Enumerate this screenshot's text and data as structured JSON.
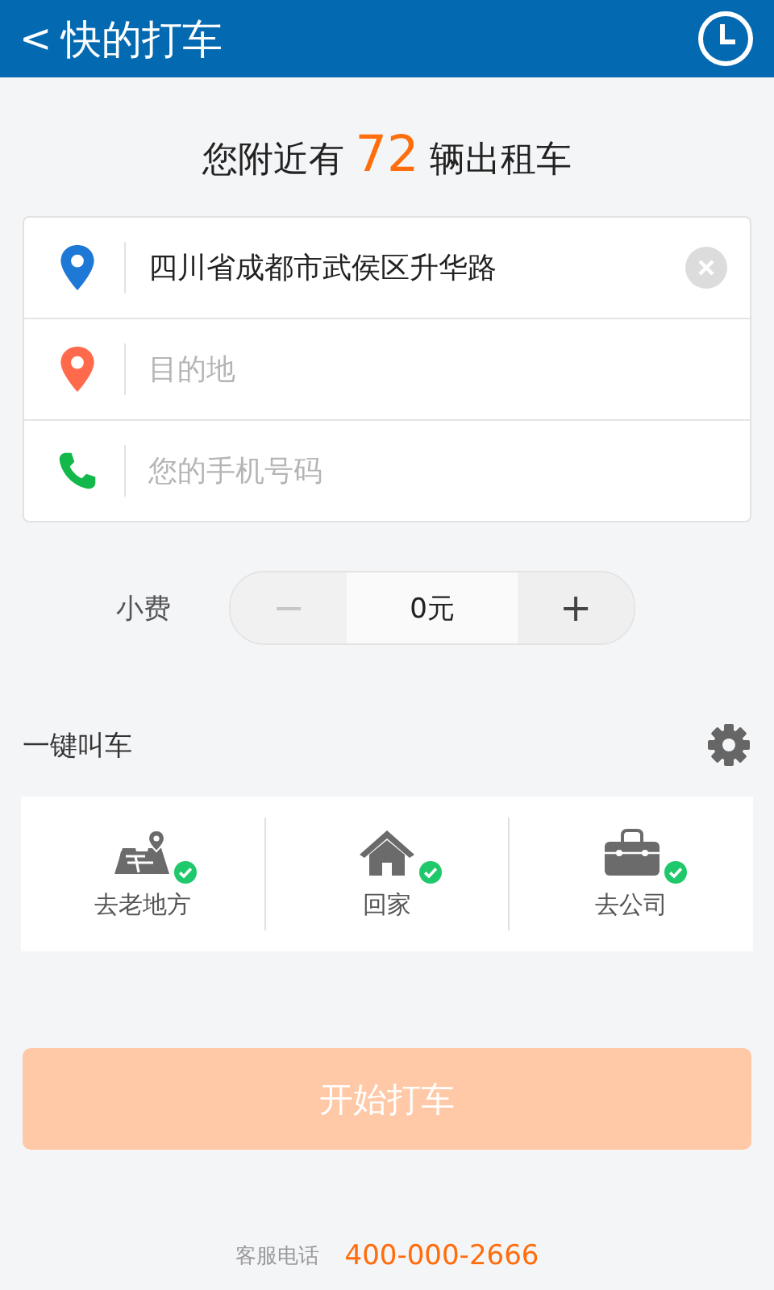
{
  "header": {
    "back": "<",
    "title": "快的打车"
  },
  "headline": {
    "before": "您附近有",
    "count": "72",
    "after": "辆出租车"
  },
  "form": [
    {
      "kind": "origin",
      "value": "四川省成都市武侯区升华路",
      "clearable": true
    },
    {
      "kind": "destination",
      "placeholder": "目的地"
    },
    {
      "kind": "phone",
      "placeholder": "您的手机号码"
    }
  ],
  "tip": {
    "label": "小费",
    "minus": "−",
    "value": "0元",
    "plus": "+",
    "minus_disabled": true
  },
  "quick_call": {
    "title": "一键叫车",
    "items": [
      {
        "kind": "place",
        "label": "去老地方",
        "checked": true
      },
      {
        "kind": "home",
        "label": "回家",
        "checked": true
      },
      {
        "kind": "work",
        "label": "去公司",
        "checked": true
      }
    ]
  },
  "start_button": {
    "label": "开始打车",
    "disabled": true
  },
  "footer": {
    "label": "客服电话",
    "phone": "400-000-2666"
  }
}
